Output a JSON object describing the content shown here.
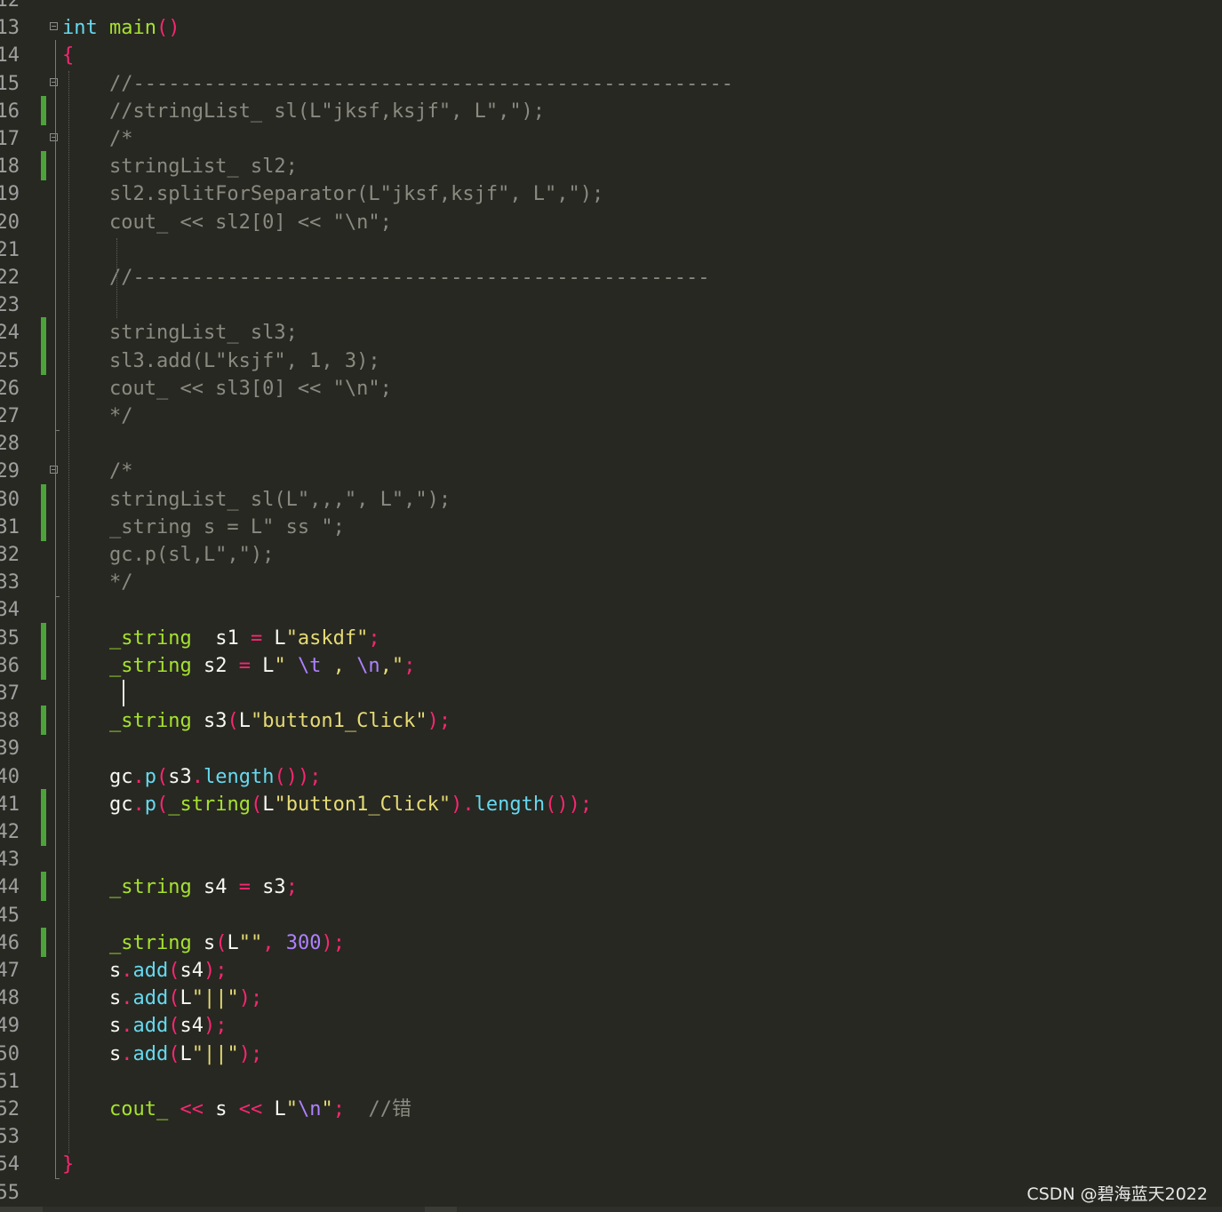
{
  "colors": {
    "background": "#272822",
    "default": "#f8f8f2",
    "keyword": "#66d9ef",
    "function": "#a6e22e",
    "punct": "#f92672",
    "string": "#e6db74",
    "escape": "#ae81ff",
    "number": "#ae81ff",
    "comment": "#8a8a80",
    "change_marker": "#4ca33a"
  },
  "lines": [
    {
      "n": "12",
      "tokens": []
    },
    {
      "n": "13",
      "fold": true,
      "tokens": [
        [
          "int",
          "kw"
        ],
        [
          " ",
          "d"
        ],
        [
          "main",
          "fn"
        ],
        [
          "()",
          "p"
        ]
      ]
    },
    {
      "n": "14",
      "tokens": [
        [
          "{",
          "p"
        ]
      ]
    },
    {
      "n": "15",
      "fold": true,
      "tokens": [
        [
          "    //---------------------------------------------------",
          "c"
        ]
      ]
    },
    {
      "n": "16",
      "changed": true,
      "tokens": [
        [
          "    //stringList_ sl(L\"jksf,ksjf\", L\",\");",
          "c"
        ]
      ]
    },
    {
      "n": "17",
      "fold": true,
      "tokens": [
        [
          "    /*",
          "c"
        ]
      ]
    },
    {
      "n": "18",
      "changed": true,
      "tokens": [
        [
          "    stringList_ sl2;",
          "c"
        ]
      ]
    },
    {
      "n": "19",
      "tokens": [
        [
          "    sl2.splitForSeparator(L\"jksf,ksjf\", L\",\");",
          "c"
        ]
      ]
    },
    {
      "n": "20",
      "tokens": [
        [
          "    cout_ << sl2[0] << \"\\n\";",
          "c"
        ]
      ]
    },
    {
      "n": "21",
      "tokens": []
    },
    {
      "n": "22",
      "tokens": [
        [
          "    //-------------------------------------------------",
          "c"
        ]
      ]
    },
    {
      "n": "23",
      "tokens": []
    },
    {
      "n": "24",
      "changed": true,
      "tokens": [
        [
          "    stringList_ sl3;",
          "c"
        ]
      ]
    },
    {
      "n": "25",
      "changed": true,
      "tokens": [
        [
          "    sl3.add(L\"ksjf\", 1, 3);",
          "c"
        ]
      ]
    },
    {
      "n": "26",
      "tokens": [
        [
          "    cout_ << sl3[0] << \"\\n\";",
          "c"
        ]
      ]
    },
    {
      "n": "27",
      "tokens": [
        [
          "    */",
          "c"
        ]
      ]
    },
    {
      "n": "28",
      "tokens": []
    },
    {
      "n": "29",
      "fold": true,
      "tokens": [
        [
          "    /*",
          "c"
        ]
      ]
    },
    {
      "n": "30",
      "changed": true,
      "tokens": [
        [
          "    stringList_ sl(L\",,,\", L\",\");",
          "c"
        ]
      ]
    },
    {
      "n": "31",
      "changed": true,
      "tokens": [
        [
          "    _string s = L\" ss \";",
          "c"
        ]
      ]
    },
    {
      "n": "32",
      "tokens": [
        [
          "    gc.p(sl,L\",\");",
          "c"
        ]
      ]
    },
    {
      "n": "33",
      "tokens": [
        [
          "    */",
          "c"
        ]
      ]
    },
    {
      "n": "34",
      "tokens": []
    },
    {
      "n": "35",
      "changed": true,
      "tokens": [
        [
          "    ",
          "d"
        ],
        [
          "_string",
          "fn"
        ],
        [
          "  s1 ",
          "d"
        ],
        [
          "=",
          "p"
        ],
        [
          " L",
          "d"
        ],
        [
          "\"askdf\"",
          "s"
        ],
        [
          ";",
          "p"
        ]
      ]
    },
    {
      "n": "36",
      "changed": true,
      "tokens": [
        [
          "    ",
          "d"
        ],
        [
          "_string",
          "fn"
        ],
        [
          " s2 ",
          "d"
        ],
        [
          "=",
          "p"
        ],
        [
          " L",
          "d"
        ],
        [
          "\" ",
          "s"
        ],
        [
          "\\t",
          "e"
        ],
        [
          " , ",
          "s"
        ],
        [
          "\\n",
          "e"
        ],
        [
          ",\"",
          "s"
        ],
        [
          ";",
          "p"
        ]
      ]
    },
    {
      "n": "37",
      "tokens": []
    },
    {
      "n": "38",
      "changed": true,
      "tokens": [
        [
          "    ",
          "d"
        ],
        [
          "_string",
          "fn"
        ],
        [
          " s3",
          "d"
        ],
        [
          "(",
          "p"
        ],
        [
          "L",
          "d"
        ],
        [
          "\"button1_Click\"",
          "s"
        ],
        [
          ");",
          "p"
        ]
      ]
    },
    {
      "n": "39",
      "tokens": []
    },
    {
      "n": "40",
      "tokens": [
        [
          "    gc",
          "d"
        ],
        [
          ".",
          "p"
        ],
        [
          "p",
          "kw"
        ],
        [
          "(",
          "p"
        ],
        [
          "s3",
          "d"
        ],
        [
          ".",
          "p"
        ],
        [
          "length",
          "kw"
        ],
        [
          "());",
          "p"
        ]
      ]
    },
    {
      "n": "41",
      "changed": true,
      "tokens": [
        [
          "    gc",
          "d"
        ],
        [
          ".",
          "p"
        ],
        [
          "p",
          "kw"
        ],
        [
          "(",
          "p"
        ],
        [
          "_string",
          "fn"
        ],
        [
          "(",
          "p"
        ],
        [
          "L",
          "d"
        ],
        [
          "\"button1_Click\"",
          "s"
        ],
        [
          ").",
          "p"
        ],
        [
          "length",
          "kw"
        ],
        [
          "());",
          "p"
        ]
      ]
    },
    {
      "n": "42",
      "changed": true,
      "tokens": []
    },
    {
      "n": "43",
      "tokens": []
    },
    {
      "n": "44",
      "changed": true,
      "tokens": [
        [
          "    ",
          "d"
        ],
        [
          "_string",
          "fn"
        ],
        [
          " s4 ",
          "d"
        ],
        [
          "=",
          "p"
        ],
        [
          " s3",
          "d"
        ],
        [
          ";",
          "p"
        ]
      ]
    },
    {
      "n": "45",
      "tokens": []
    },
    {
      "n": "46",
      "changed": true,
      "tokens": [
        [
          "    ",
          "d"
        ],
        [
          "_string",
          "fn"
        ],
        [
          " s",
          "d"
        ],
        [
          "(",
          "p"
        ],
        [
          "L",
          "d"
        ],
        [
          "\"\"",
          "s"
        ],
        [
          ", ",
          "p"
        ],
        [
          "300",
          "num"
        ],
        [
          ");",
          "p"
        ]
      ]
    },
    {
      "n": "47",
      "tokens": [
        [
          "    s",
          "d"
        ],
        [
          ".",
          "p"
        ],
        [
          "add",
          "kw"
        ],
        [
          "(",
          "p"
        ],
        [
          "s4",
          "d"
        ],
        [
          ");",
          "p"
        ]
      ]
    },
    {
      "n": "48",
      "tokens": [
        [
          "    s",
          "d"
        ],
        [
          ".",
          "p"
        ],
        [
          "add",
          "kw"
        ],
        [
          "(",
          "p"
        ],
        [
          "L",
          "d"
        ],
        [
          "\"||\"",
          "s"
        ],
        [
          ");",
          "p"
        ]
      ]
    },
    {
      "n": "49",
      "tokens": [
        [
          "    s",
          "d"
        ],
        [
          ".",
          "p"
        ],
        [
          "add",
          "kw"
        ],
        [
          "(",
          "p"
        ],
        [
          "s4",
          "d"
        ],
        [
          ");",
          "p"
        ]
      ]
    },
    {
      "n": "50",
      "tokens": [
        [
          "    s",
          "d"
        ],
        [
          ".",
          "p"
        ],
        [
          "add",
          "kw"
        ],
        [
          "(",
          "p"
        ],
        [
          "L",
          "d"
        ],
        [
          "\"||\"",
          "s"
        ],
        [
          ");",
          "p"
        ]
      ]
    },
    {
      "n": "51",
      "tokens": []
    },
    {
      "n": "52",
      "tokens": [
        [
          "    ",
          "d"
        ],
        [
          "cout_",
          "fn"
        ],
        [
          " ",
          "d"
        ],
        [
          "<<",
          "p"
        ],
        [
          " s ",
          "d"
        ],
        [
          "<<",
          "p"
        ],
        [
          " L",
          "d"
        ],
        [
          "\"",
          "s"
        ],
        [
          "\\n",
          "e"
        ],
        [
          "\"",
          "s"
        ],
        [
          ";",
          "p"
        ],
        [
          "  //错",
          "c"
        ]
      ]
    },
    {
      "n": "53",
      "tokens": []
    },
    {
      "n": "54",
      "tokens": [
        [
          "}",
          "p"
        ]
      ]
    },
    {
      "n": "55",
      "tokens": []
    }
  ],
  "watermark": "CSDN @碧海蓝天2022"
}
